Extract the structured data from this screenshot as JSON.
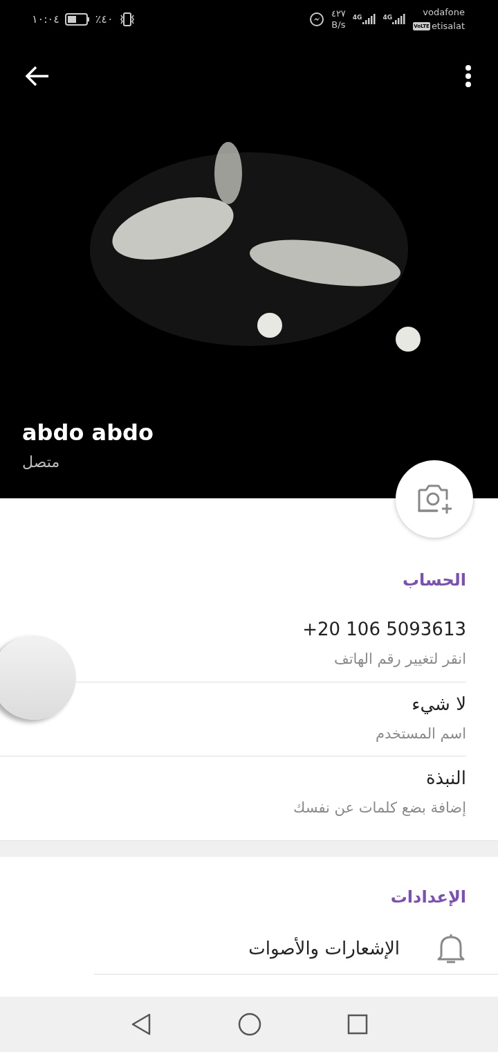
{
  "status_bar": {
    "time": "١٠:٠٤",
    "battery": "٪٤٠",
    "speed": "٤٢٧",
    "speed_unit": "B/s",
    "network_1": "4G",
    "network_2": "4G",
    "carrier_1": "vodafone",
    "volte": "VoLTE",
    "carrier_2": "etisalat"
  },
  "header": {
    "name": "abdo abdo",
    "status": "متصل"
  },
  "account": {
    "title": "الحساب",
    "rows": [
      {
        "value": "+20 106 5093613",
        "hint": "انقر لتغيير رقم الهاتف"
      },
      {
        "value": "لا شيء",
        "hint": "اسم المستخدم"
      },
      {
        "value": "النبذة",
        "hint": "إضافة بضع كلمات عن نفسك"
      }
    ]
  },
  "settings": {
    "title": "الإعدادات",
    "items": [
      {
        "label": "الإشعارات والأصوات"
      }
    ]
  }
}
